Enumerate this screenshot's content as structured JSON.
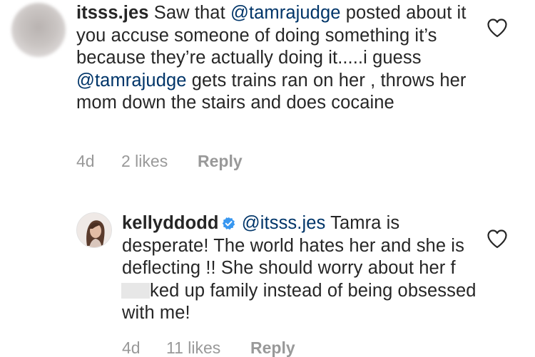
{
  "comments": [
    {
      "username": "itsss.jes",
      "avatar_icon": "blurred-avatar",
      "segments": [
        {
          "text": " Saw that "
        },
        {
          "mention": "@tamrajudge"
        },
        {
          "text": " posted about it you accuse someone of doing something it’s because they’re actually doing it.....i guess "
        },
        {
          "mention": "@tamrajudge"
        },
        {
          "text": " gets trains ran on her , throws her mom down the stairs and does cocaine"
        }
      ],
      "time": "4d",
      "likes": "2 likes",
      "reply": "Reply",
      "like_icon": "heart-outline-icon"
    },
    {
      "username": "kellyddodd",
      "verified": true,
      "avatar_icon": "profile-photo",
      "segments": [
        {
          "text": " "
        },
        {
          "mention": "@itsss.jes"
        },
        {
          "text": " Tamra is desperate! The world hates her and she is deflecting !! She should worry about her f"
        },
        {
          "redacted": true
        },
        {
          "text": "ked up family instead of being obsessed with me!"
        }
      ],
      "time": "4d",
      "likes": "11 likes",
      "reply": "Reply",
      "like_icon": "heart-outline-icon"
    }
  ],
  "colors": {
    "text": "#262626",
    "mention": "#003569",
    "meta": "#999999",
    "verified": "#3897f0"
  }
}
